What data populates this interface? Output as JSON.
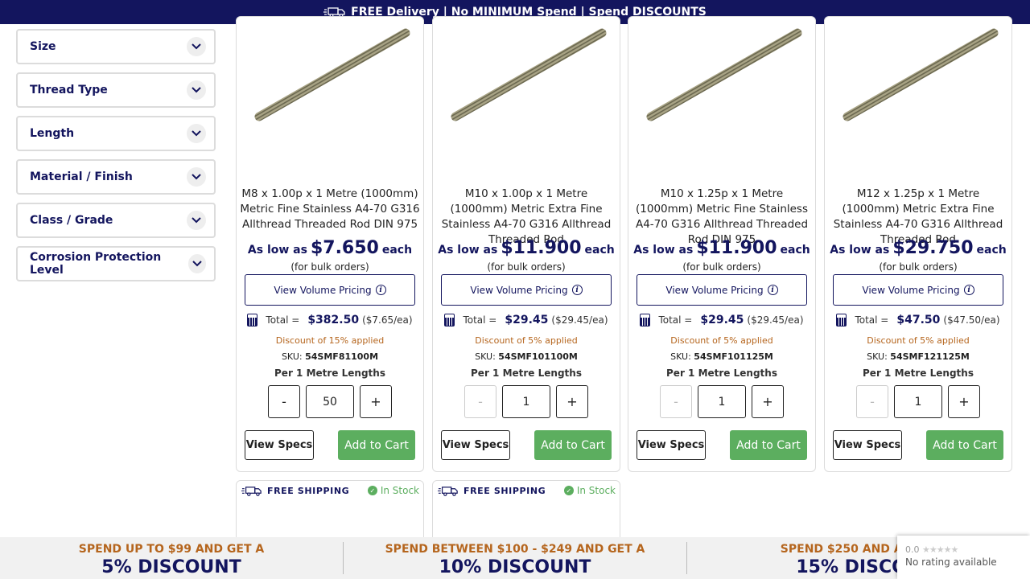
{
  "banner": {
    "text": "FREE Delivery | No MINIMUM Spend | Spend DISCOUNTS",
    "icon": "truck-icon"
  },
  "filters": [
    {
      "label": "Size"
    },
    {
      "label": "Thread Type"
    },
    {
      "label": "Length"
    },
    {
      "label": "Material / Finish"
    },
    {
      "label": "Class / Grade"
    },
    {
      "label": "Corrosion Protection Level"
    }
  ],
  "common": {
    "as_low_as": "As low as",
    "each": "each",
    "bulk": "(for bulk orders)",
    "view_volume_pricing": "View Volume Pricing",
    "total_label": "Total =",
    "sku_label": "SKU:",
    "per_unit": "Per 1 Metre Lengths",
    "minus": "-",
    "plus": "+",
    "view_specs": "View Specs",
    "add_to_cart": "Add to Cart",
    "free_shipping": "FREE SHIPPING",
    "in_stock": "In Stock"
  },
  "products": [
    {
      "title": "M8 x 1.00p x 1 Metre (1000mm) Metric Fine Stainless A4-70 G316 Allthread Threaded Rod DIN 975",
      "price": "$7.650",
      "total": "$382.50",
      "per_each": "($7.65/ea)",
      "discount": "Discount of 15% applied",
      "sku": "54SMF81100M",
      "qty": "50",
      "minus_disabled": false
    },
    {
      "title": "M10 x 1.00p x 1 Metre (1000mm) Metric Extra Fine Stainless A4-70 G316 Allthread Threaded Rod",
      "price": "$11.900",
      "total": "$29.45",
      "per_each": "($29.45/ea)",
      "discount": "Discount of 5% applied",
      "sku": "54SMF101100M",
      "qty": "1",
      "minus_disabled": true
    },
    {
      "title": "M10 x 1.25p x 1 Metre (1000mm) Metric Fine Stainless A4-70 G316 Allthread Threaded Rod DIN 975",
      "price": "$11.900",
      "total": "$29.45",
      "per_each": "($29.45/ea)",
      "discount": "Discount of 5% applied",
      "sku": "54SMF101125M",
      "qty": "1",
      "minus_disabled": true
    },
    {
      "title": "M12 x 1.25p x 1 Metre (1000mm) Metric Extra Fine Stainless A4-70 G316 Allthread Threaded Rod",
      "price": "$29.750",
      "total": "$47.50",
      "per_each": "($47.50/ea)",
      "discount": "Discount of 5% applied",
      "sku": "54SMF121125M",
      "qty": "1",
      "minus_disabled": true
    }
  ],
  "discount_tiers": [
    {
      "line1": "SPEND UP TO $99 AND GET A",
      "line2": "5% DISCOUNT"
    },
    {
      "line1": "SPEND BETWEEN $100 - $249 AND GET A",
      "line2": "10% DISCOUNT"
    },
    {
      "line1": "SPEND $250 AND ABOVE",
      "line2": "15% DISCOU"
    }
  ],
  "rating_widget": {
    "score": "0.0",
    "text": "No rating available"
  },
  "colors": {
    "navy": "#13155e",
    "green": "#5cae5f",
    "orange": "#b5651d"
  }
}
